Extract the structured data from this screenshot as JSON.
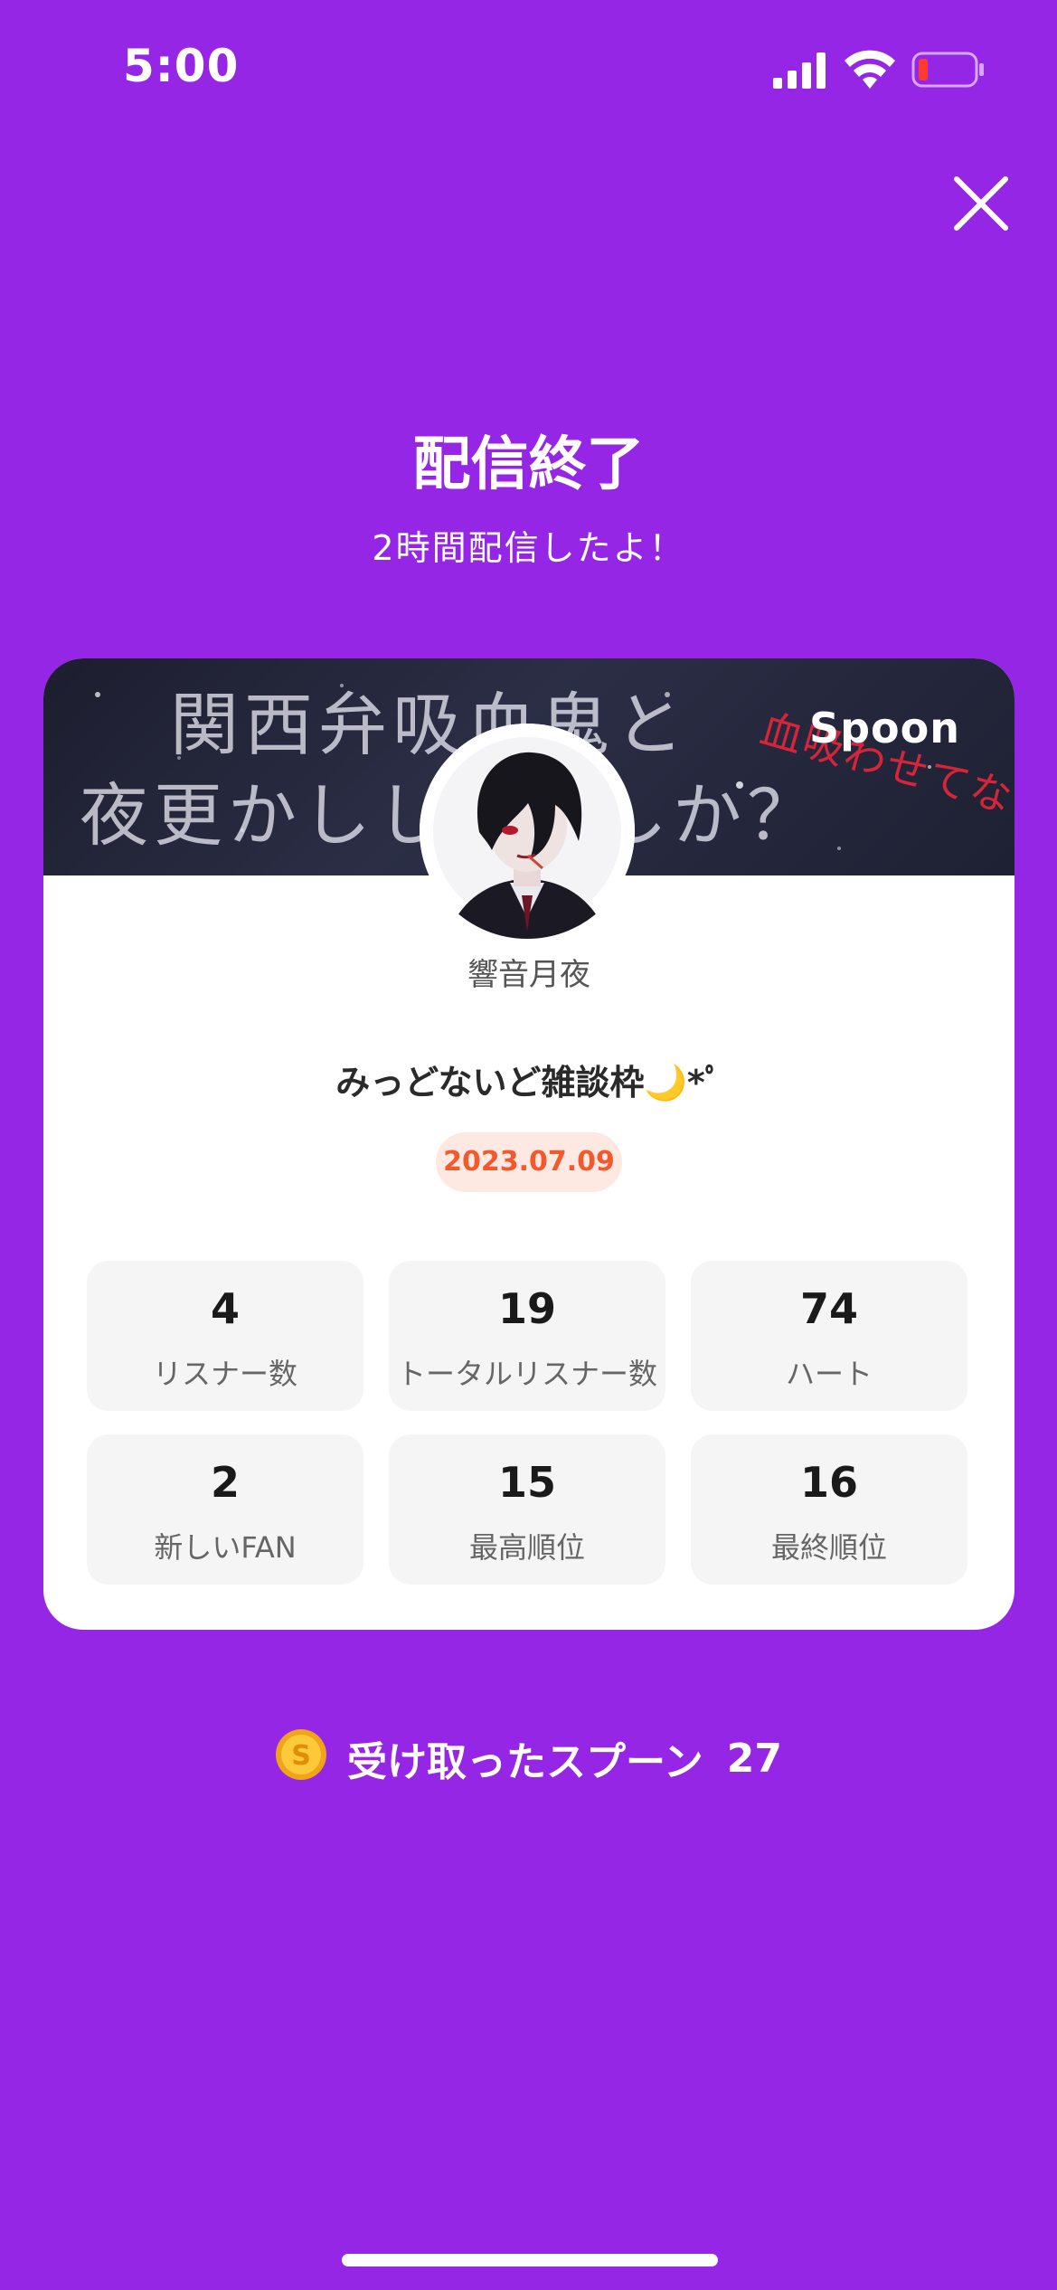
{
  "status_bar": {
    "time": "5:00"
  },
  "header": {
    "title": "配信終了",
    "subtitle": "2時間配信したよ！"
  },
  "card": {
    "banner": {
      "line1": "関西弁吸血鬼と",
      "line2": "夜更かしし　　しか？",
      "red_text": "血吸わせてな",
      "logo": "Spoon"
    },
    "host_name": "響音月夜",
    "live_title": "みっどないど雑談枠🌙*ﾟ",
    "date": "2023.07.09",
    "stats": [
      {
        "value": "4",
        "label": "リスナー数"
      },
      {
        "value": "19",
        "label": "トータルリスナー数"
      },
      {
        "value": "74",
        "label": "ハート"
      },
      {
        "value": "2",
        "label": "新しいFAN"
      },
      {
        "value": "15",
        "label": "最高順位"
      },
      {
        "value": "16",
        "label": "最終順位"
      }
    ]
  },
  "spoons": {
    "label": "受け取ったスプーン",
    "count": "27"
  },
  "icons": {
    "close": "close-icon",
    "coin": "coin-icon",
    "signal": "signal-icon",
    "wifi": "wifi-icon",
    "battery": "battery-icon"
  },
  "colors": {
    "background": "#9526e6",
    "date_badge_bg": "#fde8e2",
    "date_text": "#f25a2d",
    "battery_low": "#ff3b30",
    "coin": "#f7b81c"
  }
}
